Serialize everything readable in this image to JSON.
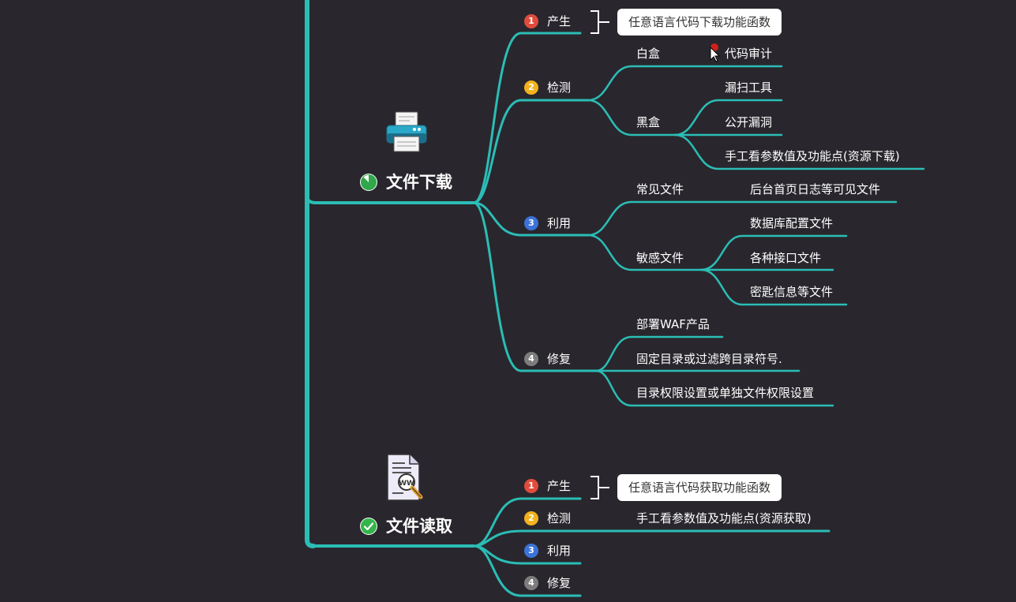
{
  "colors": {
    "background": "#29272d",
    "branch": "#2bbdb6",
    "callout_bg": "#ffffff"
  },
  "topics": [
    {
      "title": "文件下载",
      "status_icon": "progress-pie-icon",
      "illustration": "printer-icon",
      "items": [
        {
          "num": "1",
          "label": "产生",
          "callout": "任意语言代码下载功能函数"
        },
        {
          "num": "2",
          "label": "检测",
          "children": [
            {
              "label": "白盒",
              "children": [
                "代码审计"
              ]
            },
            {
              "label": "黑盒",
              "children": [
                "漏扫工具",
                "公开漏洞",
                "手工看参数值及功能点(资源下载)"
              ]
            }
          ]
        },
        {
          "num": "3",
          "label": "利用",
          "children": [
            {
              "label": "常见文件",
              "children": [
                "后台首页日志等可见文件"
              ]
            },
            {
              "label": "敏感文件",
              "children": [
                "数据库配置文件",
                "各种接口文件",
                "密匙信息等文件"
              ]
            }
          ]
        },
        {
          "num": "4",
          "label": "修复",
          "children": [
            "部署WAF产品",
            "固定目录或过滤跨目录符号.",
            "目录权限设置或单独文件权限设置"
          ]
        }
      ]
    },
    {
      "title": "文件读取",
      "status_icon": "check-circle-icon",
      "illustration": "www-document-search-icon",
      "items": [
        {
          "num": "1",
          "label": "产生",
          "callout": "任意语言代码获取功能函数"
        },
        {
          "num": "2",
          "label": "检测",
          "children": [
            "手工看参数值及功能点(资源获取)"
          ]
        },
        {
          "num": "3",
          "label": "利用"
        },
        {
          "num": "4",
          "label": "修复"
        }
      ]
    }
  ]
}
